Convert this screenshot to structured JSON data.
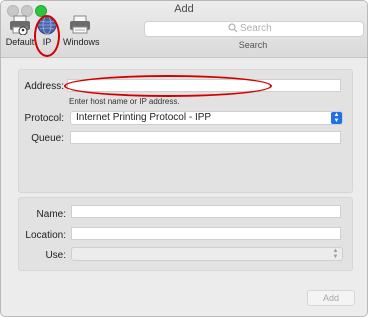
{
  "window": {
    "title": "Add"
  },
  "toolbar": {
    "tools": [
      {
        "label": "Default",
        "icon": "printer-default-icon"
      },
      {
        "label": "IP",
        "icon": "globe-icon"
      },
      {
        "label": "Windows",
        "icon": "printer-windows-icon"
      }
    ],
    "selected": "IP"
  },
  "search": {
    "placeholder": "Search",
    "caption": "Search"
  },
  "form": {
    "address": {
      "label": "Address:",
      "value": "",
      "hint": "Enter host name or IP address."
    },
    "protocol": {
      "label": "Protocol:",
      "value": "Internet Printing Protocol - IPP"
    },
    "queue": {
      "label": "Queue:",
      "value": ""
    },
    "name": {
      "label": "Name:",
      "value": ""
    },
    "location": {
      "label": "Location:",
      "value": ""
    },
    "use": {
      "label": "Use:",
      "value": ""
    }
  },
  "actions": {
    "add_label": "Add"
  },
  "colors": {
    "annotation": "#d40000",
    "accent": "#1f6fe5",
    "zoom_button": "#2dc441"
  }
}
